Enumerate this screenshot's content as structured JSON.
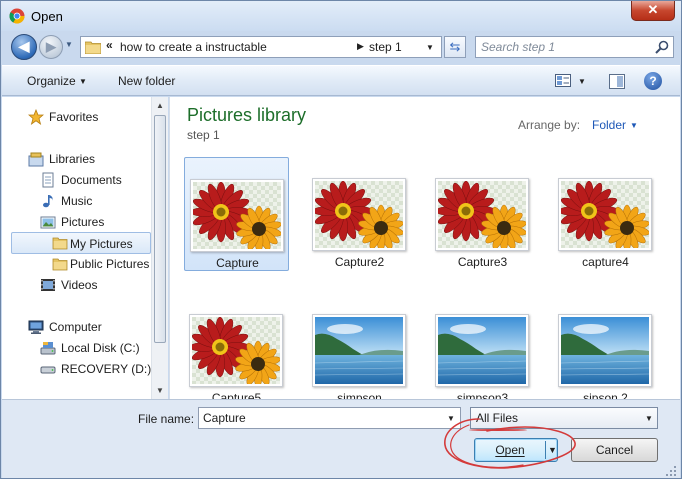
{
  "window": {
    "title": "Open",
    "close_glyph": "✕"
  },
  "nav": {
    "back_glyph": "◀",
    "forward_glyph": "▶",
    "history_glyph": "▼",
    "breadcrumb_overflow": "«",
    "breadcrumb": [
      "how to create a instructable",
      "step 1"
    ],
    "breadcrumb_sep": "▶",
    "dropdown_glyph": "▼",
    "refresh_glyph": "⇆",
    "search_placeholder": "Search step 1"
  },
  "toolbar": {
    "organize_label": "Organize",
    "new_folder_label": "New folder",
    "caret": "▼",
    "help_glyph": "?"
  },
  "sidebar": {
    "items": [
      {
        "label": "Favorites",
        "icon": "star-icon"
      },
      {
        "label": "Libraries",
        "icon": "libraries-icon"
      },
      {
        "label": "Documents",
        "icon": "documents-icon"
      },
      {
        "label": "Music",
        "icon": "music-icon"
      },
      {
        "label": "Pictures",
        "icon": "pictures-icon"
      },
      {
        "label": "My Pictures",
        "icon": "folder-icon",
        "selected": true
      },
      {
        "label": "Public Pictures",
        "icon": "folder-icon"
      },
      {
        "label": "Videos",
        "icon": "videos-icon"
      },
      {
        "label": "Computer",
        "icon": "computer-icon"
      },
      {
        "label": "Local Disk (C:)",
        "icon": "disk-icon"
      },
      {
        "label": "RECOVERY (D:)",
        "icon": "drive-icon"
      }
    ],
    "scroll_up": "▲",
    "scroll_down": "▼"
  },
  "library": {
    "title": "Pictures library",
    "subtitle": "step 1",
    "arrange_label": "Arrange by:",
    "arrange_value": "Folder",
    "arrange_caret": "▼"
  },
  "files": [
    {
      "name": "Capture",
      "thumb": "flowers",
      "selected": true
    },
    {
      "name": "Capture2",
      "thumb": "flowers"
    },
    {
      "name": "Capture3",
      "thumb": "flowers"
    },
    {
      "name": "capture4",
      "thumb": "flowers"
    },
    {
      "name": "Capture5",
      "thumb": "flowers"
    },
    {
      "name": "simpson",
      "thumb": "landscape"
    },
    {
      "name": "simpson3",
      "thumb": "landscape"
    },
    {
      "name": "sipson 2",
      "thumb": "landscape"
    }
  ],
  "footer": {
    "file_name_label": "File name:",
    "file_name_value": "Capture",
    "file_type_value": "All Files",
    "dropdown_glyph": "▼",
    "open_label": "Open",
    "open_caret": "▼",
    "cancel_label": "Cancel"
  },
  "colors": {
    "library_title": "#1d6e2a",
    "link_blue": "#1e58b7",
    "annotation_red": "#d43a3a"
  }
}
